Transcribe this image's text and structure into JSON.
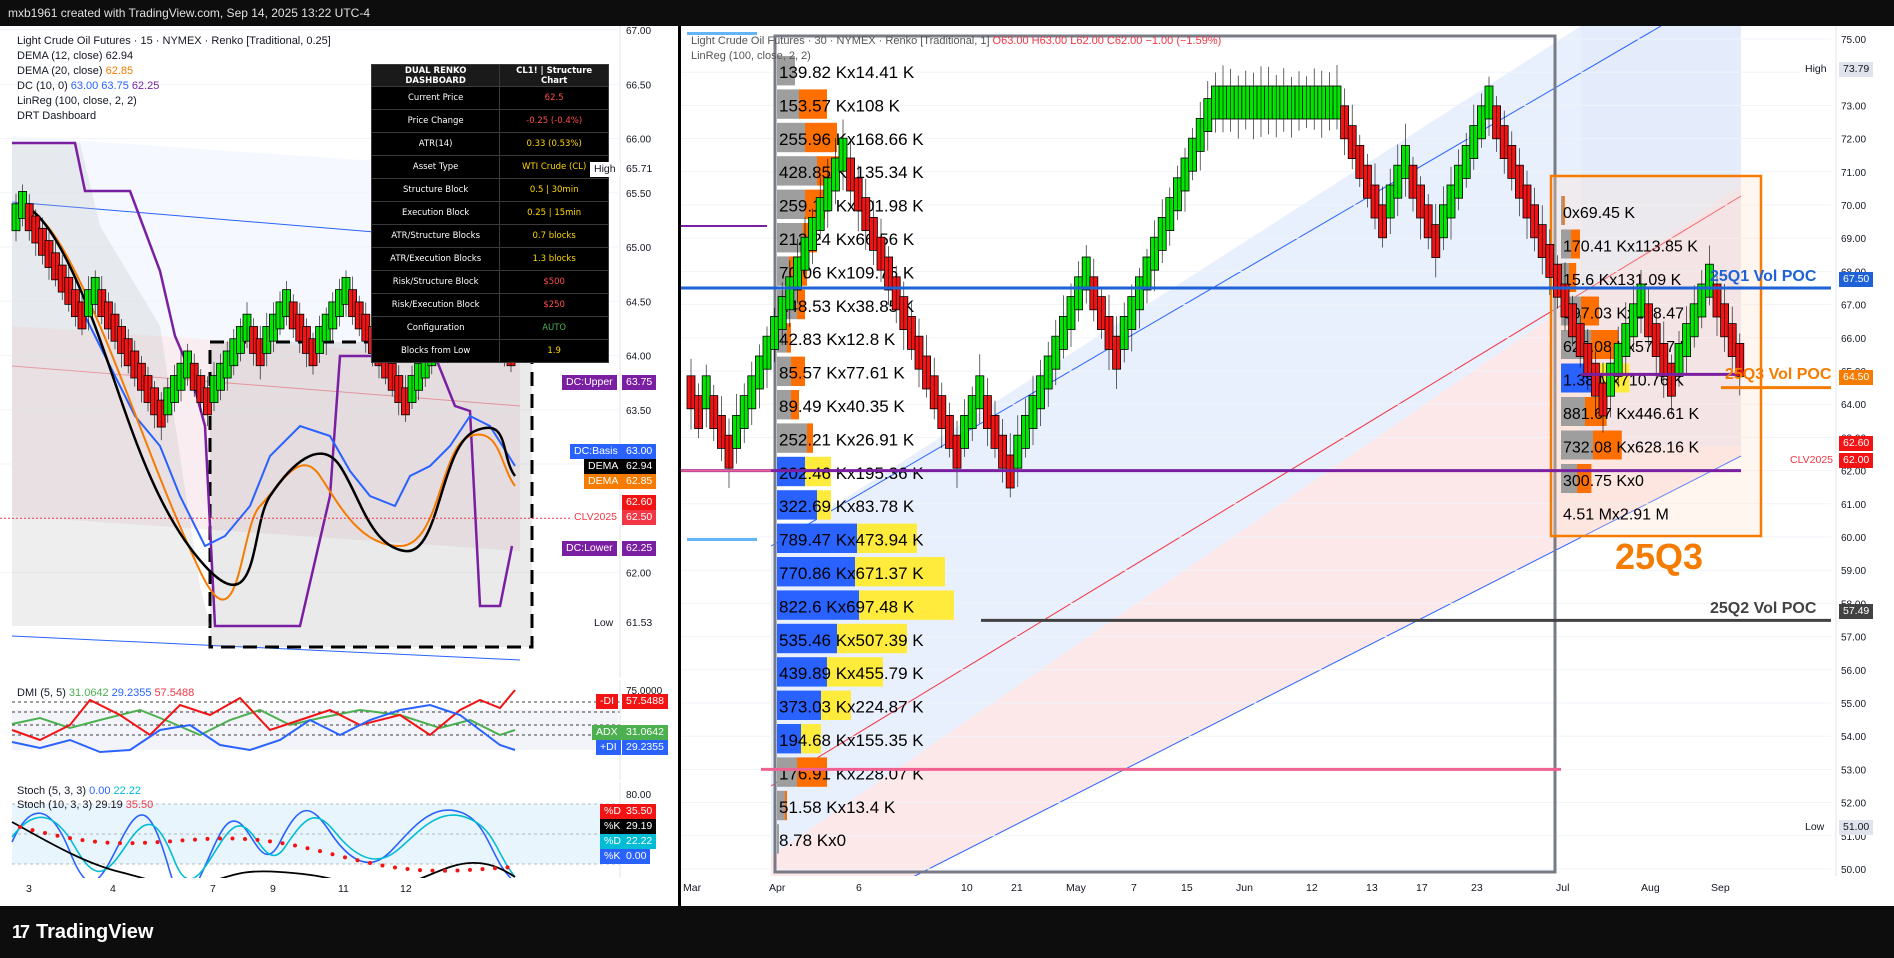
{
  "header": {
    "title": "mxb1961 created with TradingView.com, Sep 14, 2025 13:22 UTC-4"
  },
  "footer": {
    "brand": "TradingView"
  },
  "left": {
    "legend": {
      "symbol": "Light Crude Oil Futures · 15 · NYMEX · Renko [Traditional, 0.25]",
      "dema12": "DEMA (12, close)",
      "dema12_val": "62.94",
      "dema20": "DEMA (20, close)",
      "dema20_val": "62.85",
      "dc": "DC (10, 0)",
      "dc_v1": "63.00",
      "dc_v2": "63.75",
      "dc_v3": "62.25",
      "linreg": "LinReg (100, close, 2, 2)",
      "drt": "DRT Dashboard"
    },
    "dashboard": {
      "title": "DUAL RENKO DASHBOARD",
      "symbol": "CL1! | Structure Chart",
      "rows": [
        {
          "label": "Current Price",
          "value": "62.5",
          "color": "#ff4d4d"
        },
        {
          "label": "Price Change",
          "value": "-0.25 (-0.4%)",
          "color": "#ff4d4d"
        },
        {
          "label": "ATR(14)",
          "value": "0.33 (0.53%)",
          "color": "#ffd700"
        },
        {
          "label": "Asset Type",
          "value": "WTI Crude (CL)",
          "color": "#ffd700"
        },
        {
          "label": "Structure Block",
          "value": "0.5 | 30min",
          "color": "#ffd700"
        },
        {
          "label": "Execution Block",
          "value": "0.25 | 15min",
          "color": "#ffd700"
        },
        {
          "label": "ATR/Structure Blocks",
          "value": "0.7 blocks",
          "color": "#ffd700"
        },
        {
          "label": "ATR/Execution Blocks",
          "value": "1.3 blocks",
          "color": "#ffd700"
        },
        {
          "label": "Risk/Structure Block",
          "value": "$500",
          "color": "#ff4d4d"
        },
        {
          "label": "Risk/Execution Block",
          "value": "$250",
          "color": "#ff4d4d"
        },
        {
          "label": "Configuration",
          "value": "AUTO",
          "color": "#4caf50"
        },
        {
          "label": "Blocks from Low",
          "value": "1.9",
          "color": "#ffd700"
        }
      ]
    },
    "price_axis": [
      "67.00",
      "66.50",
      "66.00",
      "65.50",
      "65.00",
      "64.50",
      "64.00",
      "63.50",
      "63.00",
      "62.50",
      "62.00"
    ],
    "labels": {
      "high": "High",
      "high_val": "65.71",
      "low": "Low",
      "low_val": "61.53",
      "dc_upper": "DC:Upper",
      "dc_upper_val": "63.75",
      "dc_basis": "DC:Basis",
      "dc_basis_val": "63.00",
      "dema1": "DEMA",
      "dema1_val": "62.94",
      "dema2": "DEMA",
      "dema2_val": "62.85",
      "price": "62.60",
      "clv": "CLV2025",
      "clv_val": "62.50",
      "dc_lower": "DC:Lower",
      "dc_lower_val": "62.25"
    },
    "dmi": {
      "legend": "DMI (5, 5)",
      "v1": "31.0642",
      "v2": "29.2355",
      "v3": "57.5488",
      "axis_top": "75.0000",
      "minus_di": "-DI",
      "minus_di_val": "57.5488",
      "adx": "ADX",
      "adx_val": "31.0642",
      "plus_di": "+DI",
      "plus_di_val": "29.2355"
    },
    "stoch": {
      "legend1": "Stoch (5, 3, 3)",
      "l1v1": "0.00",
      "l1v2": "22.22",
      "legend2": "Stoch (10, 3, 3)",
      "l2v1": "29.19",
      "l2v2": "35.50",
      "axis_top": "80.00",
      "d1": "%D",
      "d1_val": "35.50",
      "k1": "%K",
      "k1_val": "29.19",
      "d2": "%D",
      "d2_val": "22.22",
      "k2": "%K",
      "k2_val": "0.00"
    },
    "xaxis": [
      "3",
      "4",
      "7",
      "9",
      "11",
      "12"
    ]
  },
  "right": {
    "legend": {
      "symbol": "Light Crude Oil Futures · 30 · NYMEX · Renko [Traditional, 1]",
      "ohlc": "O63.00 H63.00 L62.00 C62.00 −1.00 (−1.59%)",
      "linreg": "LinReg (100, close, 2, 2)"
    },
    "price_axis": [
      "75.00",
      "74.00",
      "73.00",
      "72.00",
      "71.00",
      "70.00",
      "69.00",
      "68.00",
      "67.00",
      "66.00",
      "65.00",
      "64.00",
      "63.00",
      "62.00",
      "61.00",
      "60.00",
      "59.00",
      "58.00",
      "57.00",
      "56.00",
      "55.00",
      "54.00",
      "53.00",
      "52.00",
      "51.00",
      "50.00"
    ],
    "volume_profile": [
      "139.82 Kx14.41 K",
      "153.57 Kx108 K",
      "255.96 Kx168.66 K",
      "428.85 Kx135.34 K",
      "259.12 Kx101.98 K",
      "212.24 Kx66.56 K",
      "70.06 Kx109.75 K",
      "148.53 Kx38.85 K",
      "42.83 Kx12.8 K",
      "85.57 Kx77.61 K",
      "89.49 Kx40.35 K",
      "252.21 Kx26.91 K",
      "202.46 Kx195.36 K",
      "322.69 Kx83.78 K",
      "789.47 Kx473.94 K",
      "770.86 Kx671.37 K",
      "822.6 Kx697.48 K",
      "535.46 Kx507.39 K",
      "439.89 Kx455.79 K",
      "373.03 Kx224.87 K",
      "194.68 Kx155.35 K",
      "176.91 Kx228.07 K",
      "51.58 Kx13.4 K",
      "8.78 Kx0"
    ],
    "q3_profile": [
      "0x69.45 K",
      "170.41 Kx113.85 K",
      "15.6 Kx131.09 K",
      "397.03 Kx238.47 K",
      "625.08 Kx573.7 K",
      "1.38 Mx710.76 K",
      "881.67 Kx446.61 K",
      "732.08 Kx628.16 K",
      "300.75 Kx0",
      "4.51 Mx2.91 M"
    ],
    "labels": {
      "high": "High",
      "high_val": "73.79",
      "q1_poc": "25Q1 Vol POC",
      "q1_val": "67.50",
      "q3_poc": "25Q3 Vol POC",
      "q3_val": "64.50",
      "price": "62.60",
      "clv": "CLV2025",
      "clv_val": "62.00",
      "q2_poc": "25Q2 Vol POC",
      "q2_val": "57.49",
      "low": "Low",
      "low_val": "51.00",
      "big": "25Q3"
    },
    "xaxis": [
      "Mar",
      "Apr",
      "6",
      "10",
      "21",
      "May",
      "7",
      "15",
      "Jun",
      "12",
      "13",
      "17",
      "23",
      "Jul",
      "Aug",
      "Sep"
    ]
  }
}
